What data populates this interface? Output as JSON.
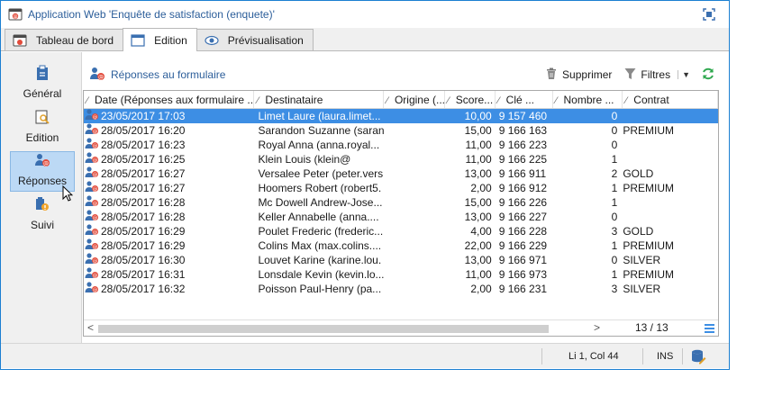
{
  "window": {
    "title": "Application Web 'Enquête de satisfaction (enquete)'"
  },
  "tabs": [
    {
      "label": "Tableau de bord",
      "active": false
    },
    {
      "label": "Edition",
      "active": true
    },
    {
      "label": "Prévisualisation",
      "active": false
    }
  ],
  "sidebar": {
    "items": [
      {
        "label": "Général"
      },
      {
        "label": "Edition"
      },
      {
        "label": "Réponses"
      },
      {
        "label": "Suivi"
      }
    ]
  },
  "toolbar": {
    "title": "Réponses au formulaire",
    "delete_label": "Supprimer",
    "filter_label": "Filtres"
  },
  "grid": {
    "columns": [
      "Date (Réponses aux formulaire ...",
      "Destinataire",
      "Origine (...",
      "Score...",
      "Clé ...",
      "Nombre ...",
      "Contrat"
    ],
    "rows": [
      {
        "date": "23/05/2017 17:03",
        "dest": "Limet Laure (laura.limet...",
        "origine": "",
        "score": "10,00",
        "cle": "9 157 460",
        "nombre": "0",
        "contrat": "",
        "selected": true
      },
      {
        "date": "28/05/2017 16:20",
        "dest": "Sarandon Suzanne (saran.",
        "origine": "",
        "score": "15,00",
        "cle": "9 166 163",
        "nombre": "0",
        "contrat": "PREMIUM"
      },
      {
        "date": "28/05/2017 16:23",
        "dest": "Royal Anna (anna.royal...",
        "origine": "",
        "score": "11,00",
        "cle": "9 166 223",
        "nombre": "0",
        "contrat": ""
      },
      {
        "date": "28/05/2017 16:25",
        "dest": "Klein Louis (klein@",
        "origine": "",
        "score": "11,00",
        "cle": "9 166 225",
        "nombre": "1",
        "contrat": ""
      },
      {
        "date": "28/05/2017 16:27",
        "dest": "Versalee Peter (peter.vers...",
        "origine": "",
        "score": "13,00",
        "cle": "9 166 911",
        "nombre": "2",
        "contrat": "GOLD"
      },
      {
        "date": "28/05/2017 16:27",
        "dest": "Hoomers Robert (robert5.",
        "origine": "",
        "score": "2,00",
        "cle": "9 166 912",
        "nombre": "1",
        "contrat": "PREMIUM"
      },
      {
        "date": "28/05/2017 16:28",
        "dest": "Mc Dowell Andrew-Jose...",
        "origine": "",
        "score": "15,00",
        "cle": "9 166 226",
        "nombre": "1",
        "contrat": ""
      },
      {
        "date": "28/05/2017 16:28",
        "dest": "Keller Annabelle (anna....",
        "origine": "",
        "score": "13,00",
        "cle": "9 166 227",
        "nombre": "0",
        "contrat": ""
      },
      {
        "date": "28/05/2017 16:29",
        "dest": "Poulet Frederic (frederic...",
        "origine": "",
        "score": "4,00",
        "cle": "9 166 228",
        "nombre": "3",
        "contrat": "GOLD"
      },
      {
        "date": "28/05/2017 16:29",
        "dest": "Colins Max (max.colins....",
        "origine": "",
        "score": "22,00",
        "cle": "9 166 229",
        "nombre": "1",
        "contrat": "PREMIUM"
      },
      {
        "date": "28/05/2017 16:30",
        "dest": "Louvet Karine (karine.lou.",
        "origine": "",
        "score": "13,00",
        "cle": "9 166 971",
        "nombre": "0",
        "contrat": "SILVER"
      },
      {
        "date": "28/05/2017 16:31",
        "dest": "Lonsdale Kevin (kevin.lo...",
        "origine": "",
        "score": "11,00",
        "cle": "9 166 973",
        "nombre": "1",
        "contrat": "PREMIUM"
      },
      {
        "date": "28/05/2017 16:32",
        "dest": "Poisson Paul-Henry (pa...",
        "origine": "",
        "score": "2,00",
        "cle": "9 166 231",
        "nombre": "3",
        "contrat": "SILVER"
      }
    ],
    "page_count": "13 / 13"
  },
  "statusbar": {
    "position": "Li 1, Col 44",
    "mode": "INS"
  },
  "icons": {
    "window": "app-web-icon",
    "maximize": "maximize-icon",
    "dashboard": "dashboard-icon",
    "edition": "edition-icon",
    "preview": "eye-icon",
    "general": "clipboard-icon",
    "edition_side": "document-search-icon",
    "responses": "user-response-icon",
    "suivi": "tracking-icon",
    "delete": "trash-icon",
    "filter": "funnel-icon",
    "refresh": "refresh-icon",
    "row": "recipient-icon",
    "database": "database-icon"
  },
  "colors": {
    "accent": "#3d8ee4",
    "selected_side": "#bcd9f5",
    "link": "#2c5e9a"
  }
}
